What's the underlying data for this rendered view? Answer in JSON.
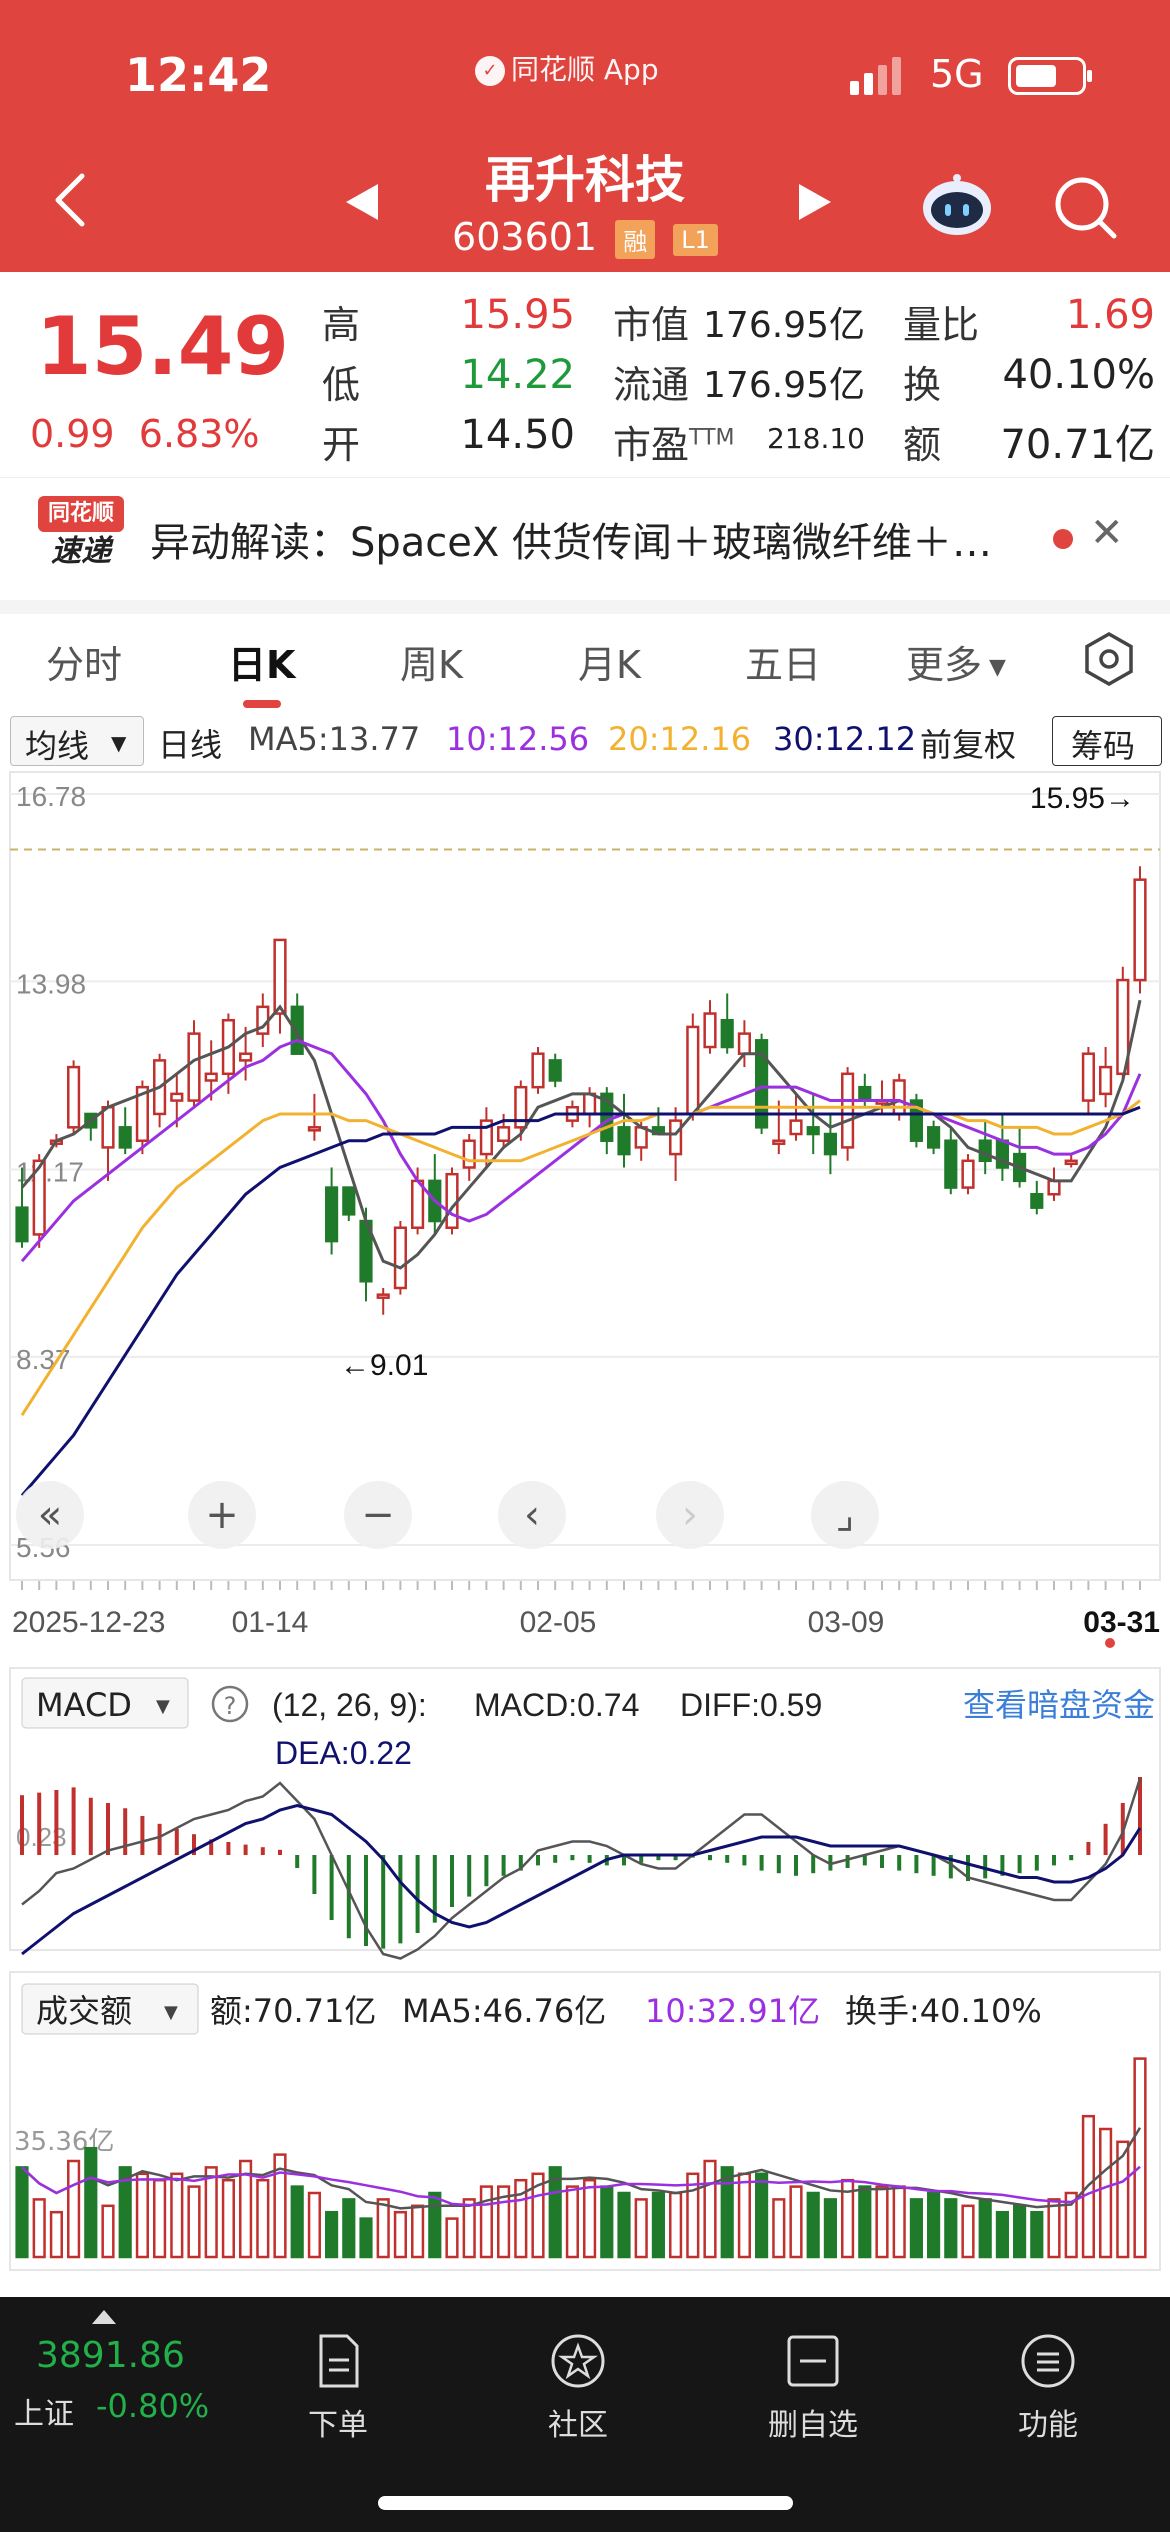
{
  "status_bar": {
    "time": "12:42",
    "source_app": "同花顺 App",
    "network": "5G"
  },
  "header": {
    "stock_name": "再升科技",
    "stock_code": "603601",
    "tag_margin": "融",
    "tag_level": "L1"
  },
  "quote": {
    "last_price": "15.49",
    "change": "0.99",
    "change_pct": "6.83%",
    "labels": {
      "high": "高",
      "low": "低",
      "open": "开",
      "market_cap": "市值",
      "float_cap": "流通",
      "pe": "市盈",
      "pe_sup": "TTM",
      "vol_ratio": "量比",
      "turnover": "换",
      "amount": "额"
    },
    "high": "15.95",
    "low": "14.22",
    "open": "14.50",
    "market_cap": "176.95亿",
    "float_cap": "176.95亿",
    "pe": "218.10",
    "vol_ratio": "1.69",
    "turnover": "40.10%",
    "amount": "70.71亿"
  },
  "news": {
    "logo_top": "同花顺",
    "logo_bottom": "速递",
    "text": "异动解读：SpaceX 供货传闻＋玻璃微纤维＋…"
  },
  "tabs": [
    "分时",
    "日K",
    "周K",
    "月K",
    "五日",
    "更多"
  ],
  "ma_row": {
    "selector": "均线",
    "period": "日线",
    "ma5": "MA5:13.77",
    "ma10": "10:12.56",
    "ma20": "20:12.16",
    "ma30": "30:12.12",
    "adjust": "前复权",
    "chips": "筹码"
  },
  "kline": {
    "y_ticks": [
      "16.78",
      "13.98",
      "11.17",
      "8.37",
      "5.56"
    ],
    "max_label": "15.95→",
    "min_label": "←9.01",
    "dates": [
      "2025-12-23",
      "01-14",
      "02-05",
      "03-09",
      "03-31"
    ]
  },
  "macd": {
    "selector": "MACD",
    "params": "(12, 26, 9):",
    "macd": "MACD:0.74",
    "diff": "DIFF:0.59",
    "dea": "DEA:0.22",
    "link": "查看暗盘资金",
    "axis_label": "0.23"
  },
  "volume": {
    "selector": "成交额",
    "amount": "额:70.71亿",
    "ma5": "MA5:46.76亿",
    "ma10": "10:32.91亿",
    "turnover": "换手:40.10%",
    "axis_label": "35.36亿"
  },
  "index": {
    "value": "3891.86",
    "name": "上证",
    "change": "-0.80%"
  },
  "bottom_nav": [
    "下单",
    "社区",
    "删自选",
    "功能"
  ],
  "colors": {
    "header": "#e0443e",
    "up": "#c0302c",
    "down": "#1f7a2a",
    "ma5": "#555555",
    "ma10": "#9b30e0",
    "ma20": "#f2b230",
    "ma30": "#10106e"
  },
  "chart_data": {
    "type": "candlestick",
    "ohlc": [
      [
        10.6,
        11.2,
        10.0,
        10.1
      ],
      [
        10.2,
        11.4,
        10.0,
        11.3
      ],
      [
        11.6,
        11.7,
        11.5,
        11.6
      ],
      [
        11.8,
        12.8,
        11.7,
        12.7
      ],
      [
        12.0,
        12.0,
        11.6,
        11.8
      ],
      [
        11.5,
        12.2,
        11.0,
        12.1
      ],
      [
        11.8,
        12.1,
        11.4,
        11.5
      ],
      [
        11.6,
        12.5,
        11.4,
        12.4
      ],
      [
        12.0,
        12.9,
        11.8,
        12.8
      ],
      [
        12.2,
        12.6,
        11.8,
        12.3
      ],
      [
        12.2,
        13.4,
        12.1,
        13.2
      ],
      [
        12.5,
        13.1,
        12.2,
        12.6
      ],
      [
        12.6,
        13.5,
        12.3,
        13.4
      ],
      [
        12.8,
        13.3,
        12.5,
        12.9
      ],
      [
        13.2,
        13.8,
        13.0,
        13.6
      ],
      [
        13.5,
        14.6,
        13.2,
        14.6
      ],
      [
        13.6,
        13.8,
        12.9,
        12.9
      ],
      [
        11.8,
        12.3,
        11.6,
        11.8
      ],
      [
        10.9,
        11.2,
        9.9,
        10.1
      ],
      [
        10.9,
        10.9,
        10.4,
        10.5
      ],
      [
        10.4,
        10.6,
        9.2,
        9.5
      ],
      [
        9.3,
        9.4,
        9.0,
        9.3
      ],
      [
        9.4,
        10.4,
        9.3,
        10.3
      ],
      [
        10.3,
        11.2,
        10.2,
        11.0
      ],
      [
        11.0,
        11.4,
        10.2,
        10.4
      ],
      [
        10.3,
        11.2,
        10.2,
        11.1
      ],
      [
        11.2,
        11.7,
        11.0,
        11.6
      ],
      [
        11.4,
        12.1,
        11.2,
        11.9
      ],
      [
        11.6,
        12.0,
        11.5,
        11.8
      ],
      [
        11.8,
        12.5,
        11.6,
        12.4
      ],
      [
        12.4,
        13.0,
        12.3,
        12.9
      ],
      [
        12.8,
        12.9,
        12.4,
        12.5
      ],
      [
        11.9,
        12.2,
        11.8,
        12.1
      ],
      [
        12.0,
        12.4,
        11.8,
        12.3
      ],
      [
        12.3,
        12.4,
        11.4,
        11.6
      ],
      [
        11.8,
        12.3,
        11.2,
        11.4
      ],
      [
        11.5,
        11.9,
        11.3,
        11.8
      ],
      [
        11.8,
        12.1,
        11.7,
        11.7
      ],
      [
        11.4,
        12.1,
        11.0,
        11.9
      ],
      [
        12.0,
        13.5,
        11.9,
        13.3
      ],
      [
        13.0,
        13.7,
        12.9,
        13.5
      ],
      [
        13.4,
        13.8,
        12.9,
        13.0
      ],
      [
        12.9,
        13.4,
        12.7,
        13.2
      ],
      [
        13.1,
        13.2,
        11.7,
        11.8
      ],
      [
        11.6,
        12.2,
        11.4,
        11.6
      ],
      [
        11.7,
        12.3,
        11.6,
        11.9
      ],
      [
        11.8,
        12.3,
        11.4,
        11.7
      ],
      [
        11.7,
        12.0,
        11.1,
        11.4
      ],
      [
        11.5,
        12.7,
        11.3,
        12.6
      ],
      [
        12.4,
        12.6,
        12.1,
        12.2
      ],
      [
        12.2,
        12.5,
        12.0,
        12.2
      ],
      [
        12.0,
        12.6,
        11.9,
        12.5
      ],
      [
        12.2,
        12.3,
        11.5,
        11.6
      ],
      [
        11.8,
        11.9,
        11.4,
        11.5
      ],
      [
        11.6,
        11.8,
        10.8,
        10.9
      ],
      [
        10.9,
        11.4,
        10.8,
        11.3
      ],
      [
        11.6,
        11.9,
        11.1,
        11.3
      ],
      [
        11.6,
        12.0,
        11.0,
        11.2
      ],
      [
        11.4,
        11.8,
        10.9,
        11.0
      ],
      [
        10.8,
        11.0,
        10.5,
        10.6
      ],
      [
        10.8,
        11.2,
        10.7,
        11.0
      ],
      [
        11.3,
        11.4,
        11.2,
        11.3
      ],
      [
        12.2,
        13.0,
        12.0,
        12.9
      ],
      [
        12.3,
        13.0,
        12.1,
        12.7
      ],
      [
        12.6,
        14.2,
        12.5,
        14.0
      ],
      [
        14.0,
        15.7,
        13.8,
        15.5
      ]
    ],
    "ma5": [
      10.9,
      11.2,
      11.6,
      11.7,
      11.9,
      12.1,
      12.2,
      12.3,
      12.4,
      12.6,
      12.8,
      12.9,
      13.0,
      13.2,
      13.3,
      13.6,
      13.2,
      12.8,
      12.0,
      11.2,
      10.4,
      9.8,
      9.7,
      9.9,
      10.2,
      10.6,
      10.9,
      11.2,
      11.5,
      11.7,
      12.1,
      12.2,
      12.3,
      12.3,
      12.2,
      12.0,
      11.8,
      11.7,
      11.7,
      12.0,
      12.3,
      12.6,
      12.9,
      12.9,
      12.6,
      12.3,
      12.0,
      11.8,
      11.9,
      12.0,
      12.1,
      12.2,
      12.1,
      12.0,
      11.8,
      11.5,
      11.4,
      11.3,
      11.2,
      11.1,
      11.0,
      11.0,
      11.4,
      11.8,
      12.5,
      13.7
    ],
    "ma10": [
      9.8,
      10.1,
      10.4,
      10.7,
      10.9,
      11.1,
      11.3,
      11.5,
      11.7,
      11.9,
      12.1,
      12.3,
      12.5,
      12.7,
      12.8,
      13.0,
      13.1,
      13.0,
      12.9,
      12.6,
      12.3,
      11.9,
      11.4,
      11.0,
      10.7,
      10.5,
      10.4,
      10.5,
      10.7,
      10.9,
      11.1,
      11.3,
      11.5,
      11.7,
      11.9,
      12.0,
      12.0,
      12.0,
      12.0,
      12.0,
      12.1,
      12.2,
      12.3,
      12.4,
      12.4,
      12.4,
      12.3,
      12.2,
      12.2,
      12.2,
      12.2,
      12.2,
      12.1,
      12.0,
      11.9,
      11.8,
      11.7,
      11.6,
      11.5,
      11.5,
      11.4,
      11.4,
      11.5,
      11.7,
      12.0,
      12.6
    ],
    "ma20": [
      7.5,
      7.9,
      8.3,
      8.7,
      9.1,
      9.5,
      9.9,
      10.3,
      10.6,
      10.9,
      11.1,
      11.3,
      11.5,
      11.7,
      11.9,
      12.0,
      12.0,
      12.0,
      12.0,
      11.9,
      11.9,
      11.8,
      11.7,
      11.6,
      11.5,
      11.4,
      11.3,
      11.3,
      11.3,
      11.3,
      11.4,
      11.5,
      11.6,
      11.7,
      11.8,
      11.9,
      11.9,
      12.0,
      12.0,
      12.0,
      12.1,
      12.1,
      12.1,
      12.1,
      12.1,
      12.1,
      12.1,
      12.1,
      12.1,
      12.1,
      12.1,
      12.1,
      12.1,
      12.0,
      12.0,
      11.9,
      11.9,
      11.8,
      11.8,
      11.8,
      11.7,
      11.7,
      11.8,
      11.9,
      12.0,
      12.2
    ],
    "ma30": [
      6.3,
      6.6,
      6.9,
      7.2,
      7.6,
      8.0,
      8.4,
      8.8,
      9.2,
      9.6,
      9.9,
      10.2,
      10.5,
      10.8,
      11.0,
      11.2,
      11.3,
      11.4,
      11.5,
      11.6,
      11.6,
      11.7,
      11.7,
      11.7,
      11.7,
      11.8,
      11.8,
      11.8,
      11.9,
      11.9,
      11.9,
      12.0,
      12.0,
      12.0,
      12.0,
      12.0,
      12.0,
      12.0,
      12.0,
      12.0,
      12.0,
      12.0,
      12.0,
      12.0,
      12.0,
      12.0,
      12.0,
      12.0,
      12.0,
      12.0,
      12.0,
      12.0,
      12.0,
      12.0,
      12.0,
      12.0,
      12.0,
      12.0,
      12.0,
      12.0,
      12.0,
      12.0,
      12.0,
      12.0,
      12.0,
      12.1
    ],
    "macd_hist": [
      0.23,
      0.24,
      0.25,
      0.26,
      0.22,
      0.2,
      0.18,
      0.15,
      0.12,
      0.1,
      0.08,
      0.06,
      0.05,
      0.04,
      0.03,
      0.02,
      -0.05,
      -0.15,
      -0.25,
      -0.32,
      -0.35,
      -0.36,
      -0.34,
      -0.3,
      -0.26,
      -0.2,
      -0.16,
      -0.12,
      -0.08,
      -0.06,
      -0.04,
      -0.03,
      -0.02,
      -0.03,
      -0.04,
      -0.04,
      -0.03,
      -0.02,
      -0.02,
      -0.01,
      -0.02,
      -0.03,
      -0.04,
      -0.06,
      -0.07,
      -0.08,
      -0.07,
      -0.06,
      -0.05,
      -0.04,
      -0.05,
      -0.06,
      -0.07,
      -0.08,
      -0.09,
      -0.1,
      -0.09,
      -0.08,
      -0.07,
      -0.06,
      -0.04,
      -0.02,
      0.05,
      0.12,
      0.2,
      0.3
    ],
    "volume": [
      28,
      18,
      14,
      30,
      34,
      16,
      28,
      26,
      24,
      26,
      22,
      28,
      24,
      30,
      24,
      32,
      22,
      20,
      14,
      18,
      12,
      18,
      14,
      16,
      20,
      12,
      18,
      22,
      22,
      24,
      26,
      28,
      22,
      24,
      22,
      20,
      18,
      20,
      20,
      26,
      30,
      28,
      26,
      26,
      18,
      22,
      20,
      18,
      24,
      22,
      22,
      22,
      18,
      20,
      18,
      16,
      18,
      14,
      16,
      14,
      18,
      20,
      44,
      40,
      36,
      62
    ],
    "volume_unit": "亿"
  }
}
